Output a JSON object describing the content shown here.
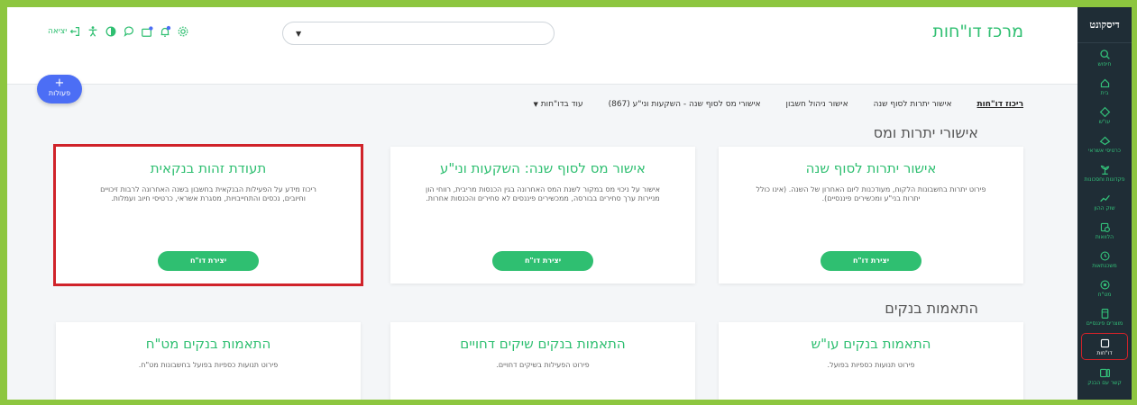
{
  "sidebar": {
    "logo": "דיסקונט",
    "items": [
      {
        "label": "חיפוש",
        "icon": "search-icon"
      },
      {
        "label": "בית",
        "icon": "home-icon"
      },
      {
        "label": "עו\"ש",
        "icon": "diamond-icon"
      },
      {
        "label": "כרטיסי אשראי",
        "icon": "card-icon"
      },
      {
        "label": "פקדונות וחסכונות",
        "icon": "plant-icon"
      },
      {
        "label": "שוק ההון",
        "icon": "trend-icon"
      },
      {
        "label": "הלוואות",
        "icon": "loan-icon"
      },
      {
        "label": "משכנתאות",
        "icon": "clock-icon"
      },
      {
        "label": "מט\"ח",
        "icon": "currency-icon"
      },
      {
        "label": "מוצרים פיננסיים",
        "icon": "folder-icon"
      },
      {
        "label": "דו\"חות",
        "icon": "reports-icon",
        "active": true
      },
      {
        "label": "קשר עם הבנק",
        "icon": "contact-icon"
      }
    ]
  },
  "header": {
    "title": "מרכז דו\"חות",
    "exit_label": "יציאה",
    "actions_label": "פעולות"
  },
  "tabs": [
    {
      "label": "ריכוז דו\"חות",
      "active": true
    },
    {
      "label": "אישור יתרות לסוף שנה"
    },
    {
      "label": "אישור ניהול חשבון"
    },
    {
      "label": "אישורי מס לסוף שנה - השקעות וני\"ע (867)"
    },
    {
      "label": "עוד בדו\"חות"
    }
  ],
  "sections": [
    {
      "title": "אישורי יתרות ומס",
      "cards": [
        {
          "title": "אישור יתרות לסוף שנה",
          "desc": "פירוט יתרות בחשבונות הלקוח, מעודכנות ליום האחרון של השנה. (אינו כולל יתרות בני\"ע ומכשירים פיננסיים).",
          "button": "יצירת דו\"ח"
        },
        {
          "title": "אישור מס לסוף שנה: השקעות וני\"ע",
          "desc": "אישור על ניכוי מס במקור לשנת המס האחרונה בגין הכנסות מריבית, רווחי הון מניירות ערך סחירים בבורסה, ממכשירים פיננסים לא סחירים והכנסות אחרות.",
          "button": "יצירת דו\"ח"
        },
        {
          "title": "תעודת זהות בנקאית",
          "desc": "ריכוז מידע על הפעילות הבנקאית בחשבון בשנה האחרונה לרבות זיכויים וחיובים, נכסים והתחייבויות, מסגרת אשראי, כרטיסי חיוב ועמלות.",
          "button": "יצירת דו\"ח"
        }
      ]
    },
    {
      "title": "התאמות בנקים",
      "cards": [
        {
          "title": "התאמות בנקים עו\"ש",
          "desc": "פירוט תנועות כספיות בפועל."
        },
        {
          "title": "התאמות בנקים שיקים דחויים",
          "desc": "פירוט הפעילות בשיקים דחויים."
        },
        {
          "title": "התאמות בנקים מט\"ח",
          "desc": "פירוט תנועות כספיות בפועל בחשבונות מט\"ח."
        }
      ]
    }
  ],
  "colors": {
    "accent": "#2fbf71",
    "sidebar": "#1f2d36",
    "highlight": "#d0232a",
    "actions": "#4c6ef5"
  }
}
